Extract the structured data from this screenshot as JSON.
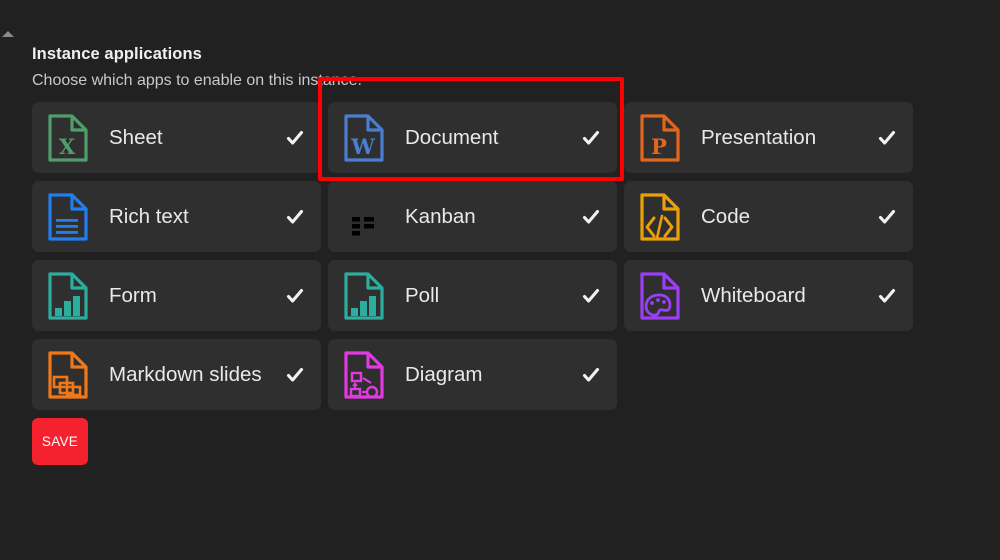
{
  "section": {
    "title": "Instance applications",
    "subtitle": "Choose which apps to enable on this instance."
  },
  "apps": [
    {
      "label": "Sheet",
      "icon": "sheet-x-document-icon",
      "color": "#4f9e6b",
      "enabled_check": "✔",
      "glyph": "X"
    },
    {
      "label": "Document",
      "icon": "word-w-document-icon",
      "color": "#4a7fd0",
      "enabled_check": "✔",
      "glyph": "W"
    },
    {
      "label": "Presentation",
      "icon": "presentation-p-document-icon",
      "color": "#e2661f",
      "enabled_check": "✔",
      "glyph": "P"
    },
    {
      "label": "Rich text",
      "icon": "rich-text-lines-document-icon",
      "color": "#1f7ef0",
      "enabled_check": "✔",
      "glyph": ""
    },
    {
      "label": "Kanban",
      "icon": "kanban-board-document-icon",
      "color": "#79c councils",
      "enabled_check": "✔",
      "glyph": ""
    },
    {
      "label": "Code",
      "icon": "code-brackets-document-icon",
      "color": "#eba00b",
      "enabled_check": "✔",
      "glyph": ""
    },
    {
      "label": "Form",
      "icon": "form-bars-document-icon",
      "color": "#2bae9e",
      "enabled_check": "✔",
      "glyph": ""
    },
    {
      "label": "Poll",
      "icon": "poll-bars-document-icon",
      "color": "#2bae9e",
      "enabled_check": "✔",
      "glyph": ""
    },
    {
      "label": "Whiteboard",
      "icon": "whiteboard-palette-document-icon",
      "color": "#9b3ef5",
      "enabled_check": "✔",
      "glyph": ""
    },
    {
      "label": "Markdown slides",
      "icon": "markdown-slides-document-icon",
      "color": "#f07818",
      "enabled_check": "✔",
      "glyph": ""
    },
    {
      "label": "Diagram",
      "icon": "diagram-flowchart-document-icon",
      "color": "#e03ae0",
      "enabled_check": "✔",
      "glyph": ""
    }
  ],
  "save_button": {
    "label": "SAVE",
    "color": "#f4212e"
  },
  "annotation": {
    "type": "red-highlight-rectangle",
    "target": "Document",
    "color": "#fe0000"
  },
  "theme": {
    "background": "#212121",
    "card_background": "#2f2f2f",
    "label_color": "#e9e9e9",
    "title_color": "#f0f0f0",
    "subtitle_color": "#c9c9c9"
  }
}
